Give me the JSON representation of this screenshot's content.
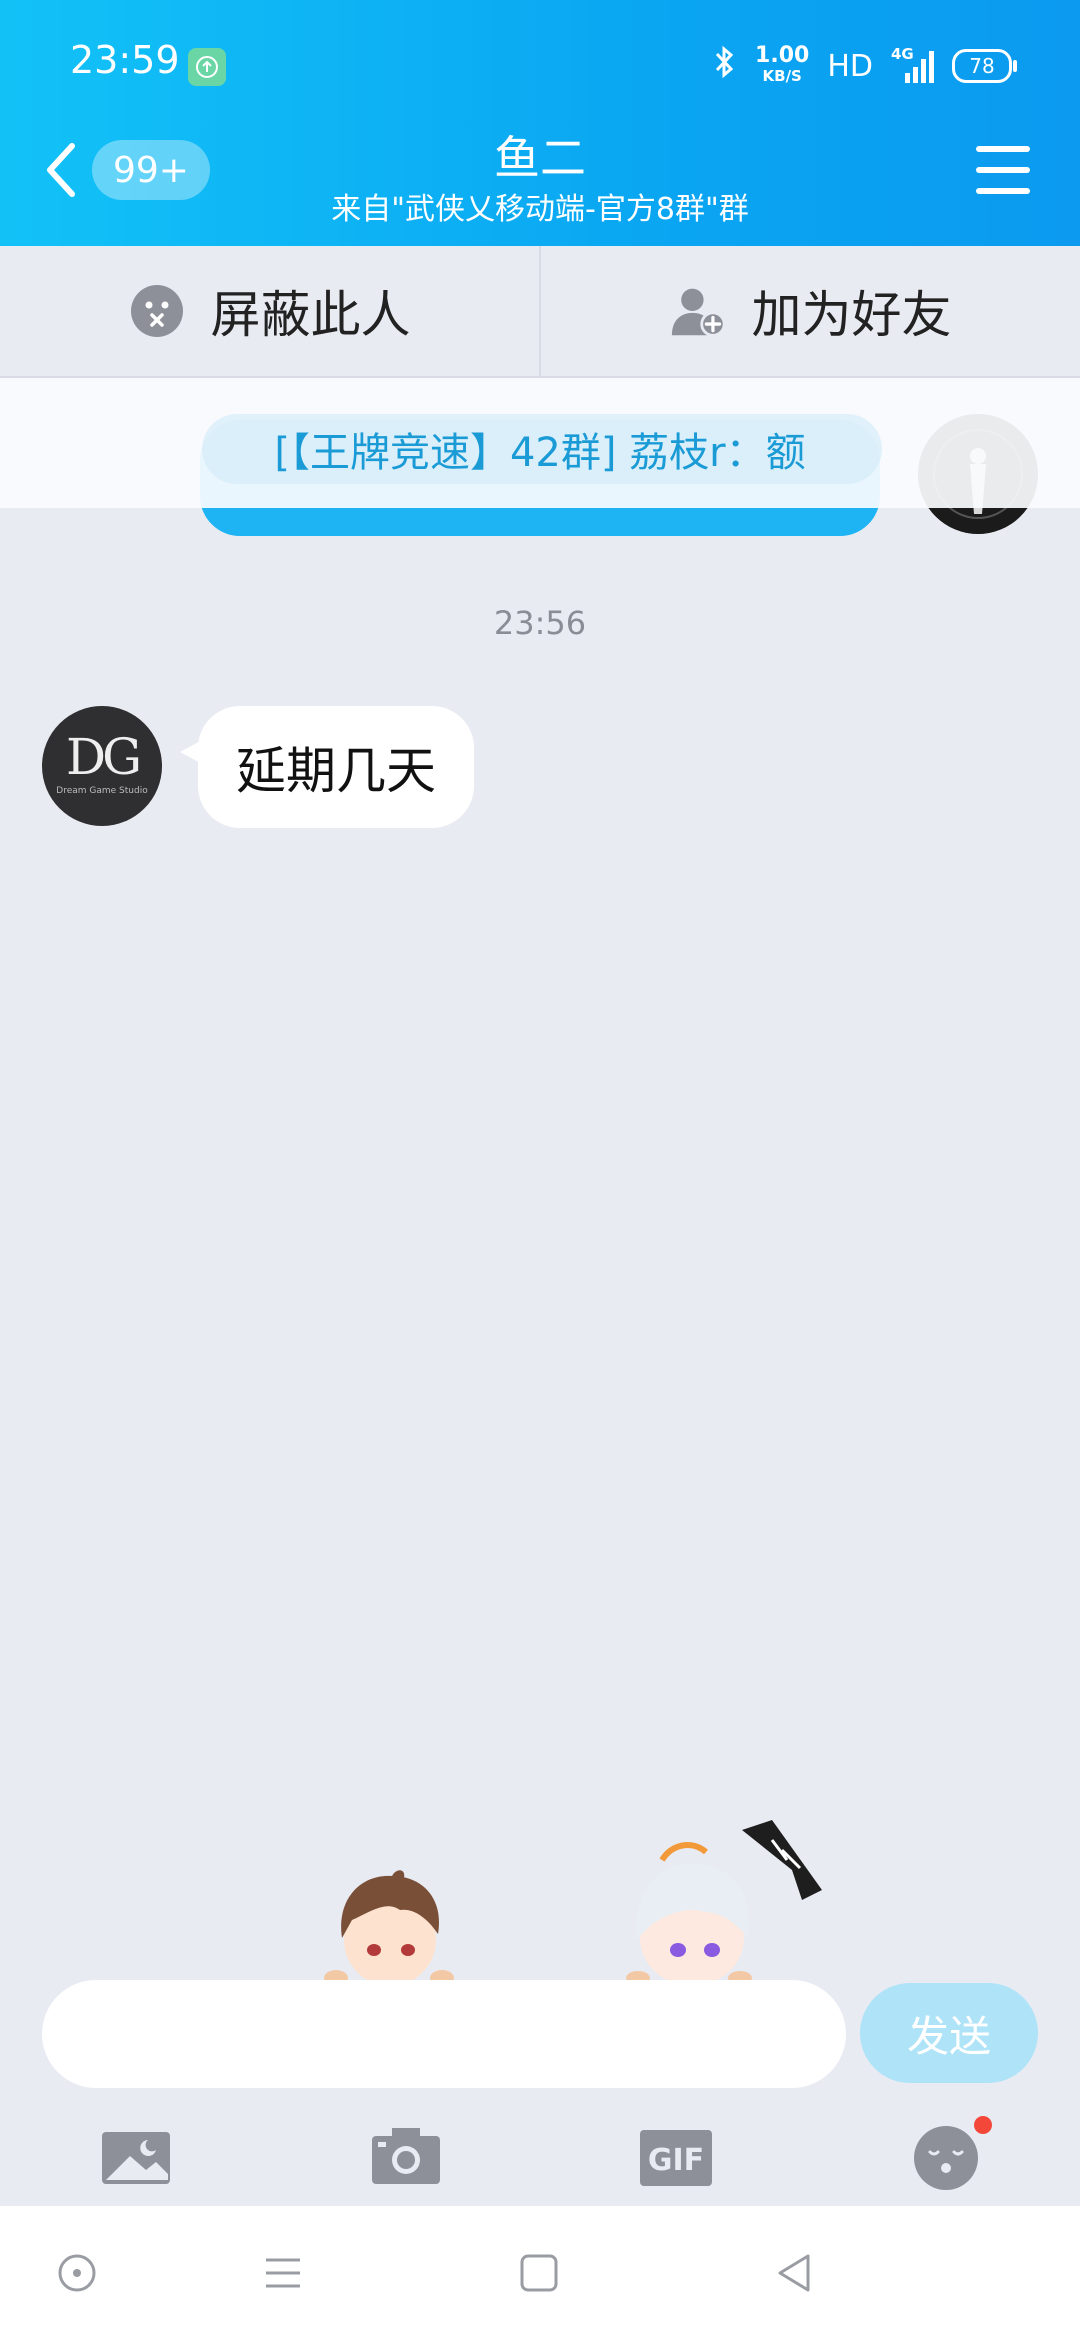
{
  "status_bar": {
    "time": "23:59",
    "speed_value": "1.00",
    "speed_unit": "KB/S",
    "hd": "HD",
    "network": "4G",
    "battery": "78"
  },
  "header": {
    "unread_badge": "99+",
    "title": "鱼二",
    "subtitle": "来自\"武侠乂移动端-官方8群\"群"
  },
  "actions": {
    "block_label": "屏蔽此人",
    "add_friend_label": "加为好友"
  },
  "banner": {
    "text": "[【王牌竞速】42群] 荔枝r：额"
  },
  "chat": {
    "timestamp": "23:56",
    "message": "延期几天",
    "avatar_text": "DG",
    "avatar_subtext": "Dream Game Studio"
  },
  "composer": {
    "input_value": "",
    "send_label": "发送"
  },
  "colors": {
    "header_start": "#12c2f7",
    "header_end": "#0b9af0",
    "chat_bg": "#e9ebf3",
    "send_disabled": "#aee3f8",
    "notice_dot": "#f3473a"
  },
  "icons": [
    "back-chevron-icon",
    "menu-icon",
    "block-face-icon",
    "add-friend-icon",
    "image-icon",
    "camera-icon",
    "gif-icon",
    "emoji-icon",
    "home-circle-icon",
    "recents-lines-icon",
    "square-icon",
    "back-triangle-icon"
  ]
}
